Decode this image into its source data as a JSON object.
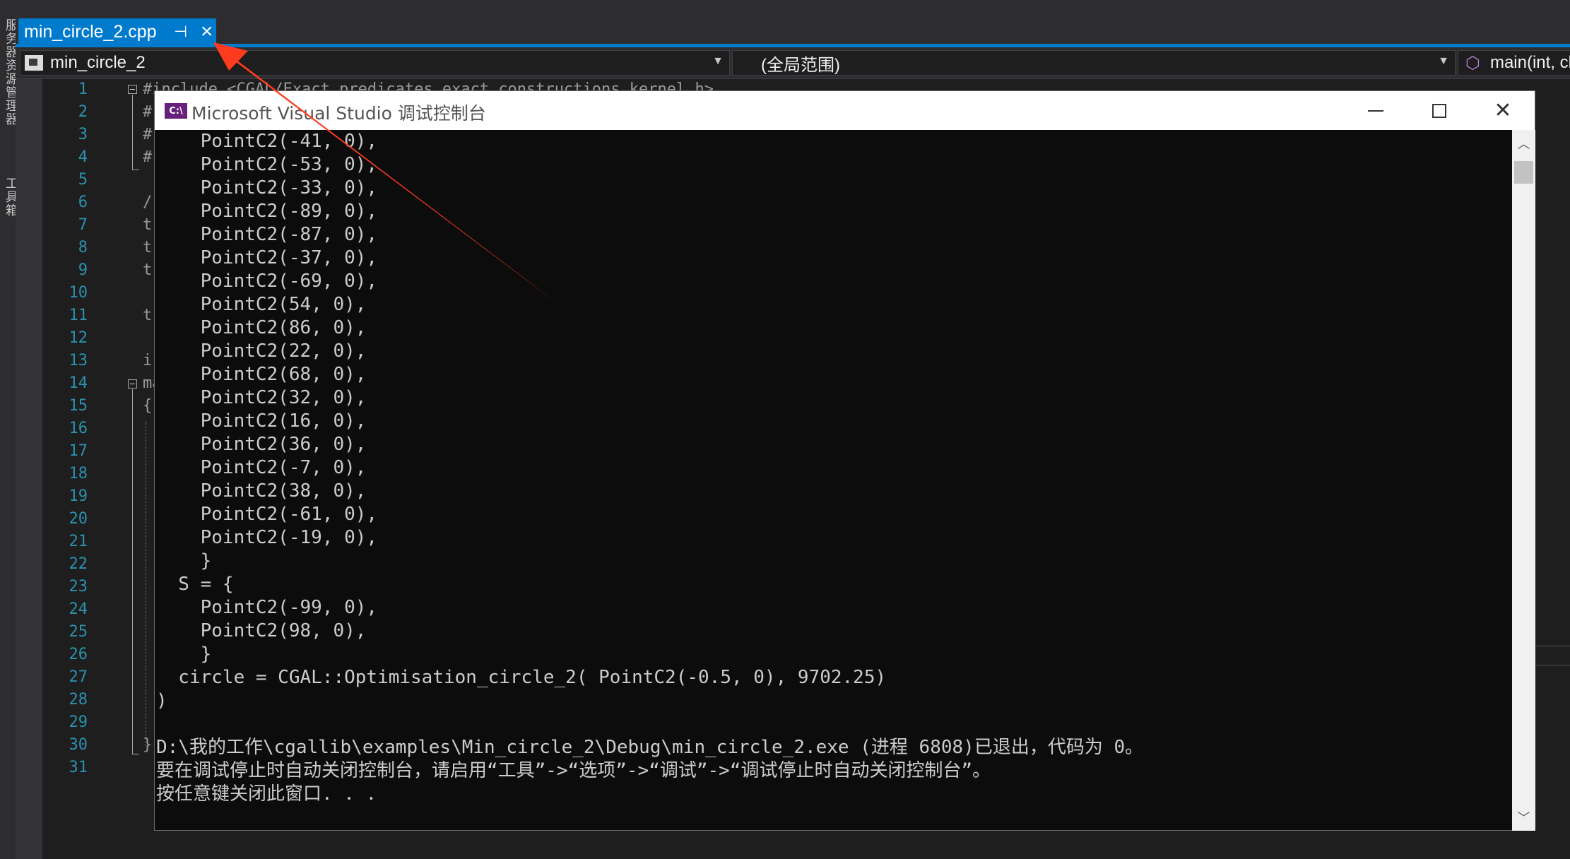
{
  "left_strip": {
    "texts": [
      "服务器资源管理器",
      "工具箱"
    ]
  },
  "tab": {
    "title": "min_circle_2.cpp",
    "pin_icon": "pin-icon",
    "close_icon": "close-icon",
    "accent": "#007acc"
  },
  "nav": {
    "project": "min_circle_2",
    "scope": "(全局范围)",
    "member": "main(int, cha"
  },
  "editor": {
    "line_numbers": [
      "1",
      "2",
      "3",
      "4",
      "5",
      "6",
      "7",
      "8",
      "9",
      "10",
      "11",
      "12",
      "13",
      "14",
      "15",
      "16",
      "17",
      "18",
      "19",
      "20",
      "21",
      "22",
      "23",
      "24",
      "25",
      "26",
      "27",
      "28",
      "29",
      "30",
      "31"
    ],
    "fragments": {
      "l1": "#include <CGAL/Exact_predicates_exact_constructions_kernel.h>",
      "l2": "#",
      "l3": "#",
      "l4": "#",
      "l6": "/",
      "l7": "t",
      "l8": "t",
      "l9": "t",
      "l11": "t",
      "l13": "i",
      "l14": "ma",
      "l15": "{",
      "l30": "}"
    }
  },
  "console": {
    "title": "Microsoft Visual Studio 调试控制台",
    "app_icon": "C:\\",
    "lines": [
      "    PointC2(-41, 0),",
      "    PointC2(-53, 0),",
      "    PointC2(-33, 0),",
      "    PointC2(-89, 0),",
      "    PointC2(-87, 0),",
      "    PointC2(-37, 0),",
      "    PointC2(-69, 0),",
      "    PointC2(54, 0),",
      "    PointC2(86, 0),",
      "    PointC2(22, 0),",
      "    PointC2(68, 0),",
      "    PointC2(32, 0),",
      "    PointC2(16, 0),",
      "    PointC2(36, 0),",
      "    PointC2(-7, 0),",
      "    PointC2(38, 0),",
      "    PointC2(-61, 0),",
      "    PointC2(-19, 0),",
      "    }",
      "  S = {",
      "    PointC2(-99, 0),",
      "    PointC2(98, 0),",
      "    }",
      "  circle = CGAL::Optimisation_circle_2( PointC2(-0.5, 0), 9702.25)",
      ")",
      "",
      "D:\\我的工作\\cgallib\\examples\\Min_circle_2\\Debug\\min_circle_2.exe (进程 6808)已退出，代码为 0。",
      "要在调试停止时自动关闭控制台，请启用“工具”->“选项”->“调试”->“调试停止时自动关闭控制台”。",
      "按任意键关闭此窗口. . ."
    ]
  },
  "colors": {
    "annotation_arrow": "#ff3b1f",
    "console_bg": "#0c0c0c",
    "editor_bg": "#1e1e1e",
    "line_number": "#2b91af"
  }
}
